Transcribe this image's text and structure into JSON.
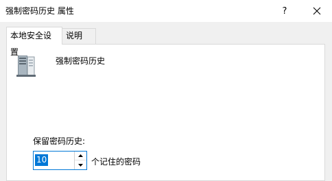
{
  "window": {
    "title": "强制密码历史 属性",
    "help_glyph": "?",
    "close_icon": "close-icon"
  },
  "tabs": [
    {
      "label": "本地安全设置",
      "active": true
    },
    {
      "label": "说明",
      "active": false
    }
  ],
  "policy": {
    "name": "强制密码历史",
    "icon": "server-icon"
  },
  "setting": {
    "label": "保留密码历史:",
    "value": "10",
    "unit": "个记住的密码"
  },
  "colors": {
    "accent": "#0078d7",
    "dialog_bg": "#f0f0f0",
    "panel_bg": "#ffffff",
    "border": "#d9d9d9"
  }
}
